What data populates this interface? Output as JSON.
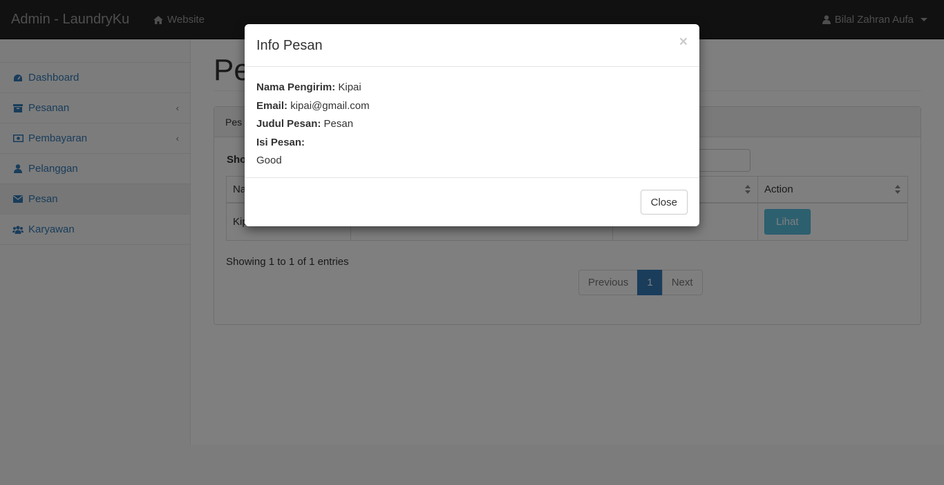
{
  "navbar": {
    "brand": "Admin - LaundryKu",
    "website_label": "Website",
    "user_name": "Bilal Zahran Aufa"
  },
  "sidebar": {
    "items": [
      {
        "label": "Dashboard",
        "icon": "dashboard-icon"
      },
      {
        "label": "Pesanan",
        "icon": "archive-icon",
        "has_submenu": true
      },
      {
        "label": "Pembayaran",
        "icon": "money-icon",
        "has_submenu": true
      },
      {
        "label": "Pelanggan",
        "icon": "user-icon"
      },
      {
        "label": "Pesan",
        "icon": "envelope-icon",
        "active": true
      },
      {
        "label": "Karyawan",
        "icon": "users-icon"
      }
    ],
    "submenu_arrow": "‹"
  },
  "page": {
    "title": "Pe",
    "panel_heading": "Pes",
    "show_label": "Sho",
    "table": {
      "headers": [
        "Na",
        "",
        "",
        "Action"
      ],
      "rows": [
        {
          "name": "Kip",
          "action_label": "Lihat"
        }
      ]
    },
    "showing_text": "Showing 1 to 1 of 1 entries",
    "pagination": {
      "previous": "Previous",
      "current": "1",
      "next": "Next"
    }
  },
  "modal": {
    "title": "Info Pesan",
    "close_x": "×",
    "fields": {
      "sender_label": "Nama Pengirim:",
      "sender_value": "Kipai",
      "email_label": "Email:",
      "email_value": "kipai@gmail.com",
      "subject_label": "Judul Pesan:",
      "subject_value": "Pesan",
      "body_label": "Isi Pesan:",
      "body_value": "Good"
    },
    "close_button": "Close"
  },
  "colors": {
    "navbar_bg": "#222222",
    "link": "#337ab7",
    "info_button": "#5bc0de",
    "backdrop": "rgba(0,0,0,0.5)"
  }
}
